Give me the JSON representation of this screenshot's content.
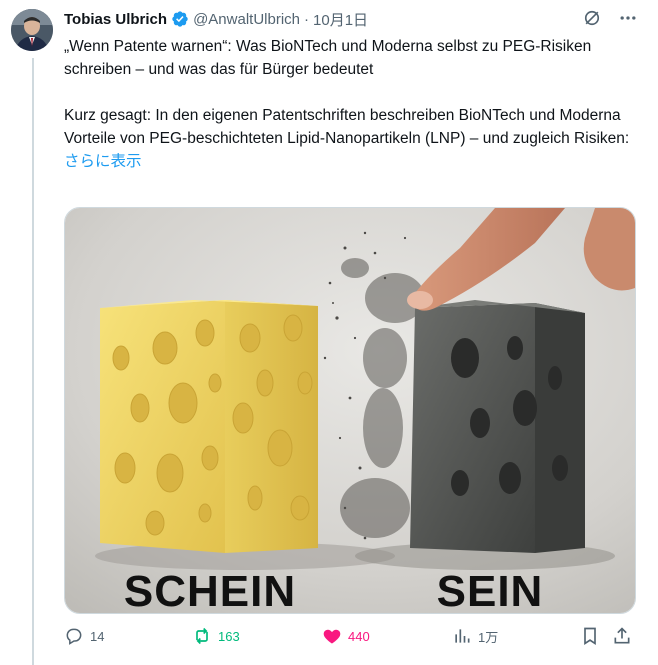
{
  "author": {
    "name": "Tobias Ulbrich",
    "handle": "@AnwaltUlbrich",
    "separator": "·",
    "date": "10月1日"
  },
  "tweet": {
    "text": "„Wenn Patente warnen“: Was BioNTech und Moderna selbst zu PEG-Risiken schreiben – und was das für Bürger bedeutet\n\nKurz gesagt: In den eigenen Patentschriften beschreiben BioNTech und Moderna Vorteile von PEG-beschichteten Lipid-Nanopartikeln (LNP) – und zugleich Risiken:",
    "show_more": "さらに表示"
  },
  "media": {
    "left_caption": "SCHEIN",
    "right_caption": "SEIN"
  },
  "actions": {
    "replies": "14",
    "reposts": "163",
    "likes": "440",
    "views": "1万"
  },
  "colors": {
    "accent": "#1d9bf0",
    "repost": "#00ba7c",
    "like": "#f91880",
    "muted": "#536471"
  },
  "icons": [
    "verified-icon",
    "grok-icon",
    "more-icon",
    "reply-icon",
    "repost-icon",
    "like-icon",
    "views-icon",
    "bookmark-icon",
    "share-icon"
  ]
}
